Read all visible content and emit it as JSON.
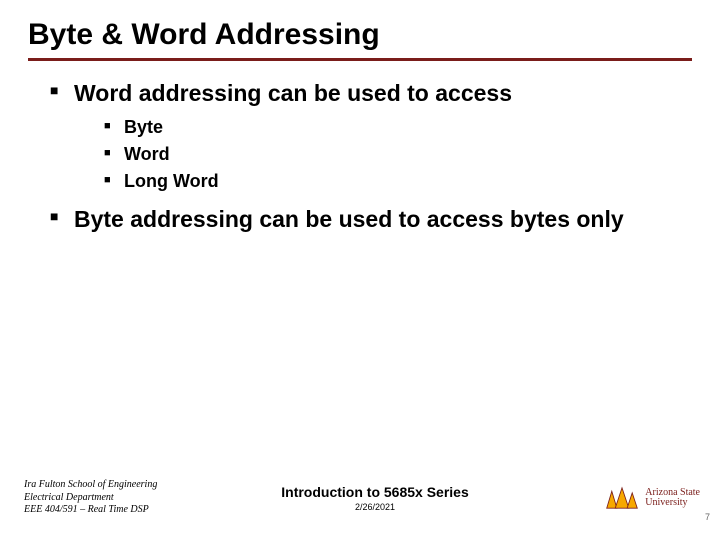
{
  "title": "Byte & Word Addressing",
  "bullets": {
    "b1": {
      "text": "Word addressing can be used to access",
      "sub": {
        "s1": "Byte",
        "s2": "Word",
        "s3": "Long Word"
      }
    },
    "b2": {
      "text": "Byte addressing can be used to access bytes only"
    }
  },
  "footer": {
    "left": {
      "l1": "Ira Fulton School of Engineering",
      "l2": "Electrical Department",
      "l3": "EEE 404/591 – Real Time DSP"
    },
    "center": {
      "course": "Introduction to 5685x Series",
      "date": "2/26/2021"
    },
    "right": {
      "logo_text_l1": "Arizona State",
      "logo_text_l2": "University"
    },
    "pagenum": "7"
  }
}
